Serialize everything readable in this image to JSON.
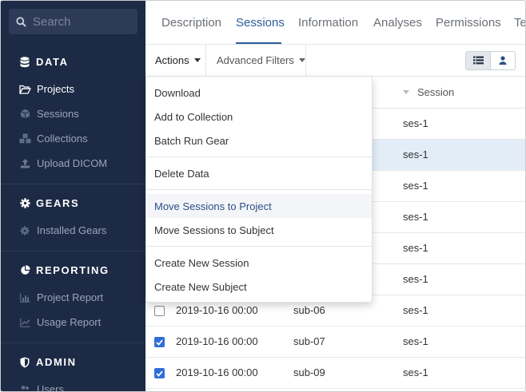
{
  "sidebar": {
    "search_placeholder": "Search",
    "sections": [
      {
        "title": "DATA",
        "icon": "database-icon"
      },
      {
        "title": "GEARS",
        "icon": "gear-icon"
      },
      {
        "title": "REPORTING",
        "icon": "pie-chart-icon"
      },
      {
        "title": "ADMIN",
        "icon": "shield-icon"
      }
    ],
    "data_items": [
      {
        "label": "Projects",
        "icon": "folder-open-icon"
      },
      {
        "label": "Sessions",
        "icon": "cube-icon"
      },
      {
        "label": "Collections",
        "icon": "cubes-icon"
      },
      {
        "label": "Upload DICOM",
        "icon": "upload-icon"
      }
    ],
    "gears_items": [
      {
        "label": "Installed Gears",
        "icon": "gear-icon"
      }
    ],
    "reporting_items": [
      {
        "label": "Project Report",
        "icon": "bar-chart-icon"
      },
      {
        "label": "Usage Report",
        "icon": "line-chart-icon"
      }
    ],
    "admin_items": [
      {
        "label": "Users",
        "icon": "users-icon"
      }
    ],
    "active_item": "Projects"
  },
  "tabs": [
    "Description",
    "Sessions",
    "Information",
    "Analyses",
    "Permissions",
    "Te"
  ],
  "active_tab": "Sessions",
  "toolbar": {
    "actions_label": "Actions",
    "advanced_filters_label": "Advanced Filters",
    "view_list_icon": "list-icon",
    "view_subject_icon": "user-icon"
  },
  "table": {
    "session_header": "Session",
    "rows": [
      {
        "date": "",
        "subject": "",
        "session": "ses-1",
        "checked": false,
        "selected": false
      },
      {
        "date": "",
        "subject": "",
        "session": "ses-1",
        "checked": true,
        "selected": true
      },
      {
        "date": "",
        "subject": "",
        "session": "ses-1",
        "checked": false,
        "selected": false
      },
      {
        "date": "",
        "subject": "",
        "session": "ses-1",
        "checked": false,
        "selected": false
      },
      {
        "date": "",
        "subject": "",
        "session": "ses-1",
        "checked": false,
        "selected": false
      },
      {
        "date": "",
        "subject": "",
        "session": "ses-1",
        "checked": false,
        "selected": false
      },
      {
        "date": "2019-10-16 00:00",
        "subject": "sub-06",
        "session": "ses-1",
        "checked": false,
        "selected": false
      },
      {
        "date": "2019-10-16 00:00",
        "subject": "sub-07",
        "session": "ses-1",
        "checked": true,
        "selected": false
      },
      {
        "date": "2019-10-16 00:00",
        "subject": "sub-09",
        "session": "ses-1",
        "checked": true,
        "selected": false
      }
    ]
  },
  "actions_menu": {
    "items": [
      {
        "label": "Download"
      },
      {
        "label": "Add to Collection"
      },
      {
        "label": "Batch Run Gear"
      },
      {
        "label": "Delete Data"
      },
      {
        "label": "Move Sessions to Project"
      },
      {
        "label": "Move Sessions to Subject"
      },
      {
        "label": "Create New Session"
      },
      {
        "label": "Create New Subject"
      }
    ],
    "highlighted": "Move Sessions to Project"
  },
  "colors": {
    "sidebar_bg": "#1d2a45",
    "accent": "#2d5c9e",
    "checkbox_checked": "#2f6fd6",
    "selected_row": "#e3edf8"
  }
}
